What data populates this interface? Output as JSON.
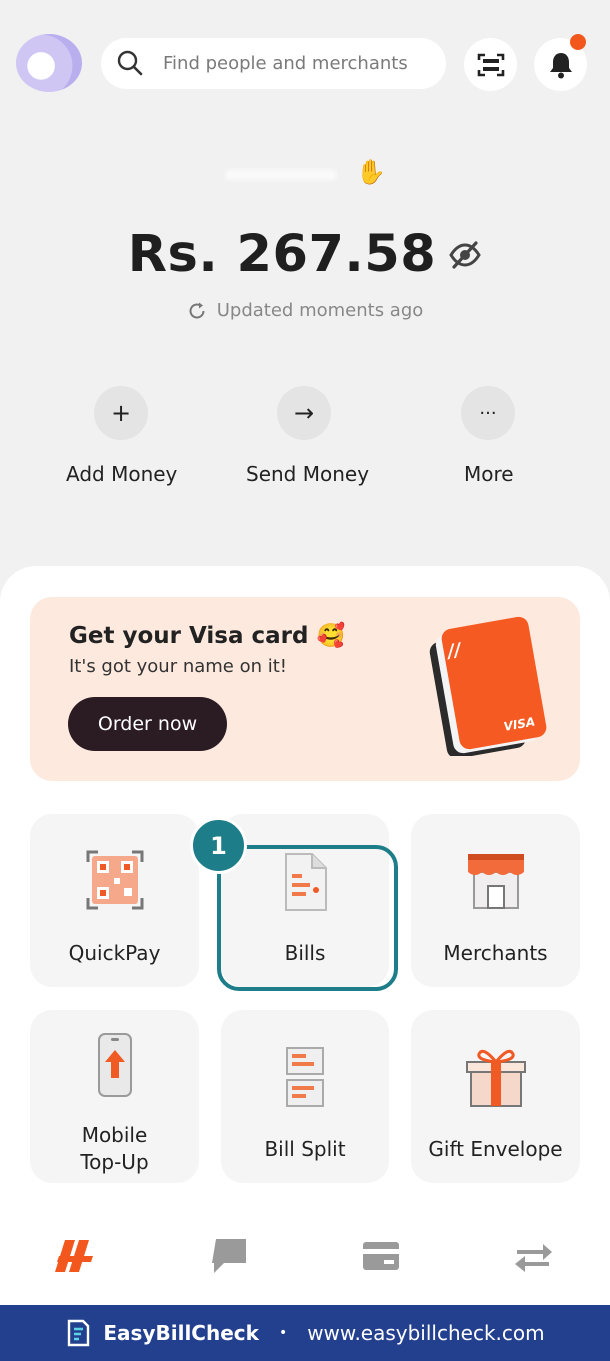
{
  "search": {
    "placeholder": "Find people and merchants"
  },
  "balance": {
    "amount": "Rs. 267.58",
    "updated": "Updated moments ago"
  },
  "actions": [
    {
      "label": "Add Money",
      "icon": "plus-icon",
      "glyph": "+"
    },
    {
      "label": "Send Money",
      "icon": "arrow-right-icon",
      "glyph": "→"
    },
    {
      "label": "More",
      "icon": "more-dots-icon",
      "glyph": "···"
    }
  ],
  "banner": {
    "title": "Get your Visa card 🥰",
    "subtitle": "It's got your name on it!",
    "button": "Order now",
    "card_text": "VISA"
  },
  "services": [
    {
      "label": "QuickPay",
      "icon": "qr-code-icon"
    },
    {
      "label": "Bills",
      "icon": "bill-document-icon"
    },
    {
      "label": "Merchants",
      "icon": "storefront-icon"
    },
    {
      "label": "Mobile Top-Up",
      "icon": "mobile-topup-icon"
    },
    {
      "label": "Bill Split",
      "icon": "bill-split-icon"
    },
    {
      "label": "Gift Envelope",
      "icon": "gift-icon"
    }
  ],
  "step_badge": "1",
  "nav": [
    {
      "icon": "home-logo-icon",
      "active": true
    },
    {
      "icon": "chat-icon",
      "active": false
    },
    {
      "icon": "card-icon",
      "active": false
    },
    {
      "icon": "transfer-icon",
      "active": false
    }
  ],
  "footer": {
    "brand": "EasyBillCheck",
    "separator": "•",
    "url": "www.easybillcheck.com"
  },
  "colors": {
    "accent": "#f2581e",
    "highlight": "#1d7e8a",
    "footer_bg": "#23408e",
    "banner_bg": "#fde9de",
    "button_dark": "#2b1b22"
  }
}
